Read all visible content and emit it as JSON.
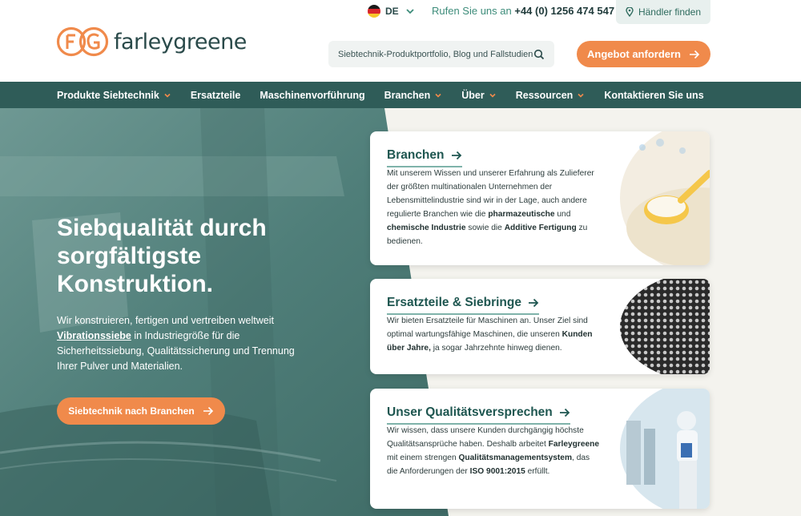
{
  "header": {
    "logo_text": "farleygreene",
    "logo_letters": "FG",
    "lang": "DE",
    "call_prefix": "Rufen Sie uns an",
    "phone": "+44 (0) 1256 474 547",
    "dealer_label": "Händler finden",
    "search_placeholder": "Siebtechnik-Produktportfolio, Blog und Fallstudien",
    "cta_label": "Angebot anfordern"
  },
  "nav": {
    "items": [
      {
        "label": "Produkte Siebtechnik",
        "dropdown": true
      },
      {
        "label": "Ersatzteile",
        "dropdown": false
      },
      {
        "label": "Maschinenvorführung",
        "dropdown": false
      },
      {
        "label": "Branchen",
        "dropdown": true
      },
      {
        "label": "Über",
        "dropdown": true
      },
      {
        "label": "Ressourcen",
        "dropdown": true
      },
      {
        "label": "Kontaktieren Sie uns",
        "dropdown": false
      }
    ]
  },
  "hero": {
    "title": "Siebqualität durch sorgfältigste Konstruktion.",
    "body_1": "Wir konstruieren, fertigen und vertreiben weltweit",
    "body_link": "Vibrationssiebe",
    "body_2": "in Industriegröße für die Sicherheitssiebung, Qualitätssicherung und Trennung Ihrer Pulver und Materialien.",
    "cta_label": "Siebtechnik nach Branchen"
  },
  "cards": [
    {
      "title": "Branchen",
      "t1": "Mit unserem Wissen und unserer Erfahrung als Zulieferer der größten multinationalen Unternehmen der Lebensmittelindustrie sind wir in der Lage, auch andere regulierte Branchen wie die",
      "b1": "pharmazeutische",
      "t2": "und",
      "b2": "chemische Industrie",
      "t3": "sowie die",
      "b3": "Additive Fertigung",
      "t4": "zu bedienen."
    },
    {
      "title": "Ersatzteile & Siebringe",
      "t1": "Wir bieten Ersatzteile für Maschinen an. Unser Ziel sind optimal wartungsfähige Maschinen, die unseren",
      "b1": "Kunden über Jahre,",
      "t2": "ja sogar Jahrzehnte hinweg dienen."
    },
    {
      "title": "Unser Qualitätsversprechen",
      "t1": "Wir wissen, dass unsere Kunden durchgängig höchste Qualitätsansprüche haben. Deshalb arbeitet",
      "b1": "Farleygreene",
      "t2": "mit einem strengen",
      "b2": "Qualitätsmanagementsystem",
      "t3": ", das die Anforderungen der",
      "b3": "ISO 9001:2015",
      "t4": "erfüllt."
    }
  ],
  "colors": {
    "brand_orange": "#f08a4b",
    "brand_teal": "#2f5c58",
    "text_teal": "#1e5650",
    "link_teal": "#3d8c7a"
  },
  "icons": [
    "flag-de-icon",
    "chevron-down-icon",
    "location-pin-icon",
    "search-icon",
    "arrow-right-icon",
    "dropdown-chevron-icon"
  ]
}
